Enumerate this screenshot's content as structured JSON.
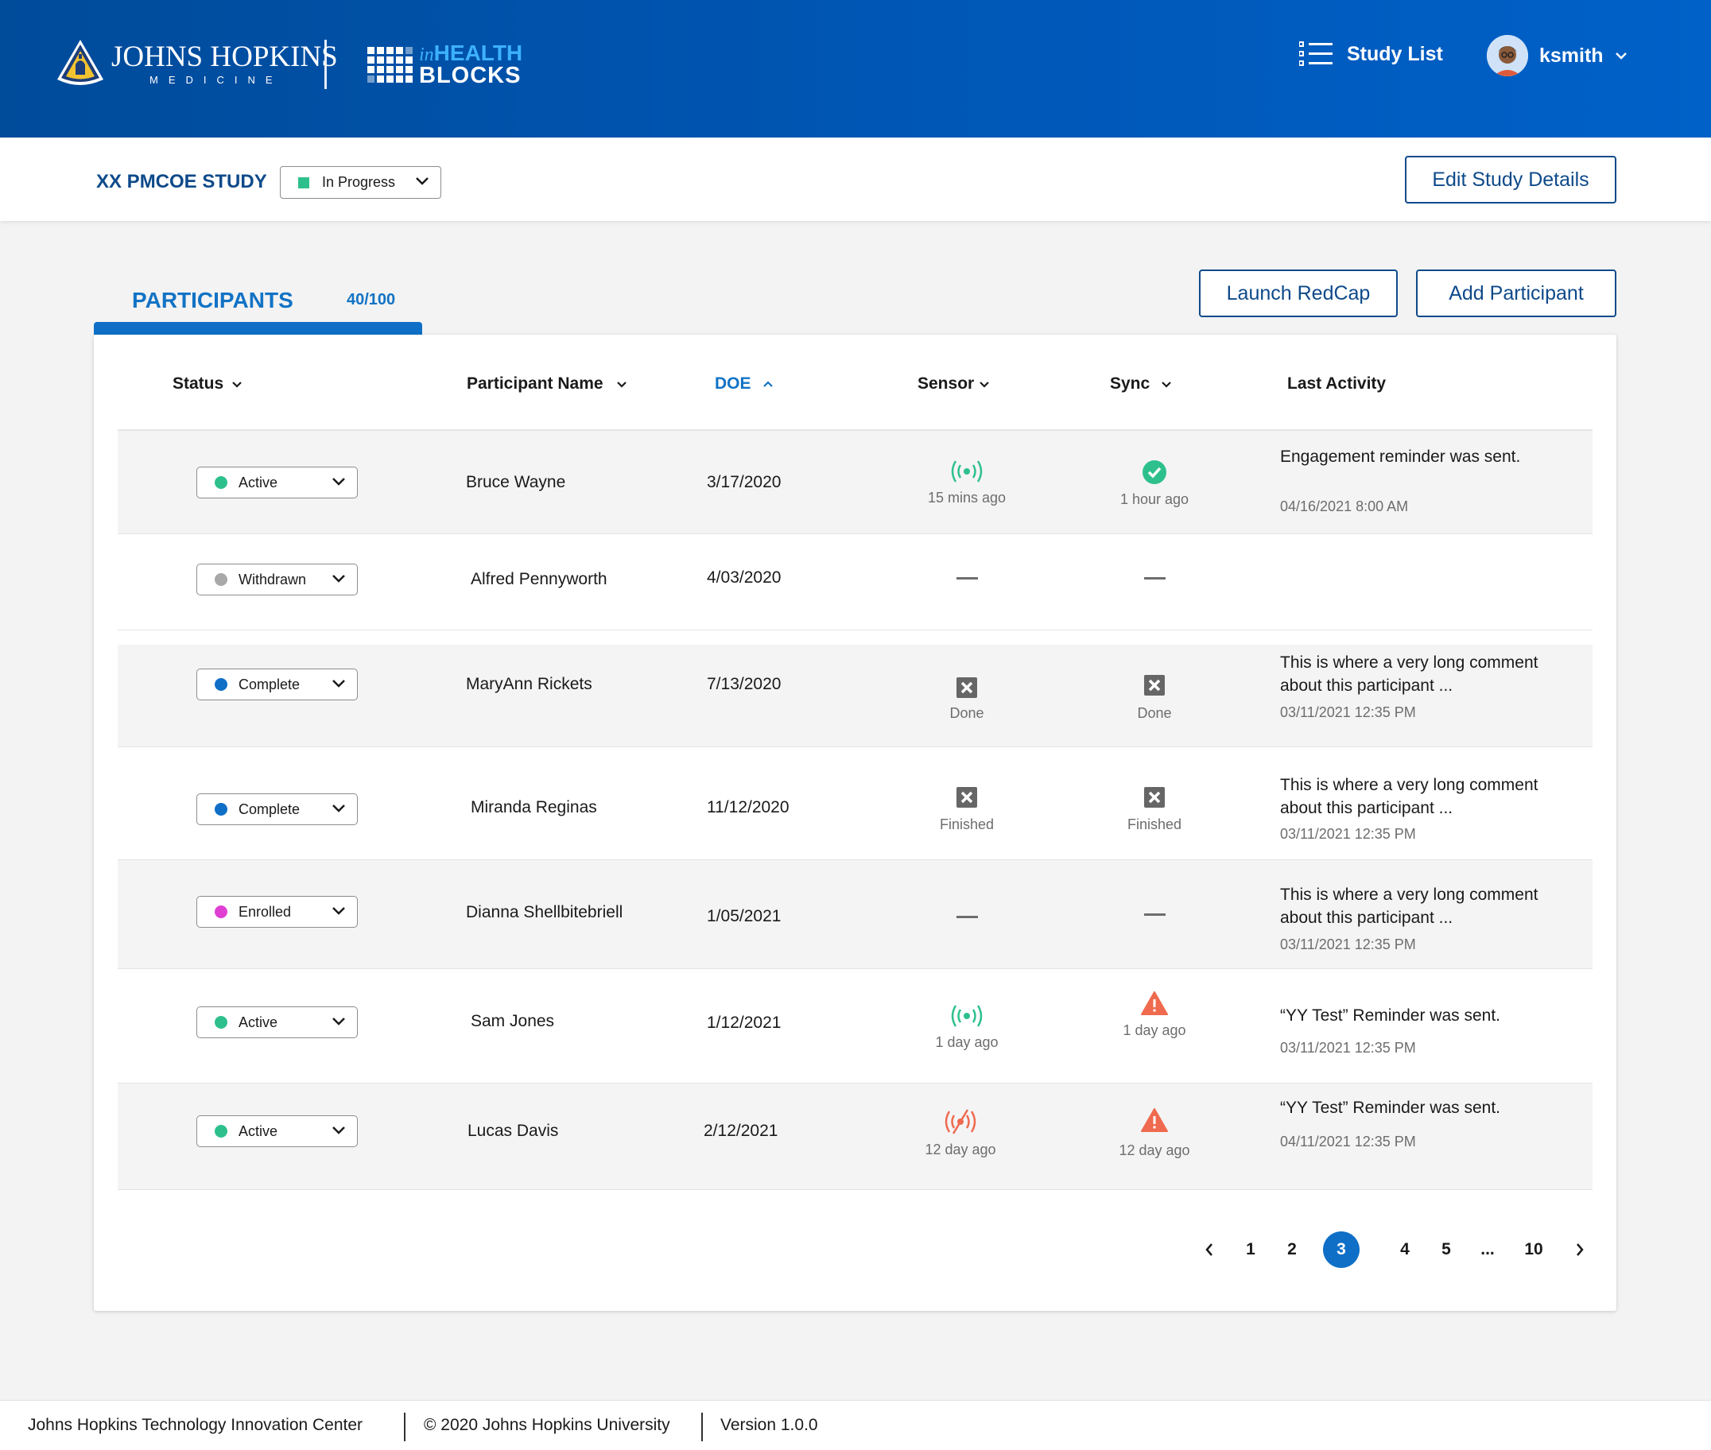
{
  "header": {
    "org_name": "JOHNS HOPKINS",
    "org_sub": "MEDICINE",
    "product_prefix": "in",
    "product_line1": "HEALTH",
    "product_line2": "BLOCKS",
    "study_list_label": "Study List",
    "username": "ksmith",
    "icons": [
      "list-icon",
      "avatar",
      "chevron-down-icon"
    ]
  },
  "study": {
    "title": "XX PMCOE STUDY",
    "status": "In Progress",
    "status_color": "#2ec08c",
    "edit_label": "Edit Study Details"
  },
  "participants": {
    "tab_label": "PARTICIPANTS",
    "count": "40/100",
    "launch_label": "Launch RedCap",
    "add_label": "Add Participant",
    "columns": [
      "Status",
      "Participant Name",
      "DOE",
      "Sensor",
      "Sync",
      "Last Activity"
    ],
    "sorted_column": "DOE",
    "rows": [
      {
        "status": "Active",
        "status_color": "#2ec08c",
        "name": "Bruce Wayne",
        "doe": "3/17/2020",
        "sensor_icon": "signal-green-icon",
        "sensor_caption": "15 mins ago",
        "sync_icon": "check-circle-icon",
        "sync_caption": "1 hour ago",
        "activity": "Engagement reminder was sent.",
        "activity_date": "04/16/2021 8:00 AM"
      },
      {
        "status": "Withdrawn",
        "status_color": "#a8a8a8",
        "name": "Alfred Pennyworth",
        "doe": "4/03/2020",
        "sensor_icon": "dash-icon",
        "sensor_caption": "",
        "sync_icon": "dash-icon",
        "sync_caption": "",
        "activity": "",
        "activity_date": ""
      },
      {
        "status": "Complete",
        "status_color": "#0f6fc6",
        "name": "MaryAnn Rickets",
        "doe": "7/13/2020",
        "sensor_icon": "x-box-icon",
        "sensor_caption": "Done",
        "sync_icon": "x-box-icon",
        "sync_caption": "Done",
        "activity": "This is where a very long comment about this participant ...",
        "activity_date": "03/11/2021 12:35 PM"
      },
      {
        "status": "Complete",
        "status_color": "#0f6fc6",
        "name": "Miranda Reginas",
        "doe": "11/12/2020",
        "sensor_icon": "x-box-icon",
        "sensor_caption": "Finished",
        "sync_icon": "x-box-icon",
        "sync_caption": "Finished",
        "activity": "This is where a very long comment about this participant ...",
        "activity_date": "03/11/2021 12:35 PM"
      },
      {
        "status": "Enrolled",
        "status_color": "#e03fd4",
        "name": "Dianna Shellbitebriell",
        "doe": "1/05/2021",
        "sensor_icon": "dash-icon",
        "sensor_caption": "",
        "sync_icon": "dash-icon",
        "sync_caption": "",
        "activity": "This is where a very long comment about this participant ...",
        "activity_date": "03/11/2021 12:35 PM"
      },
      {
        "status": "Active",
        "status_color": "#2ec08c",
        "name": "Sam Jones",
        "doe": "1/12/2021",
        "sensor_icon": "signal-green-icon",
        "sensor_caption": "1 day ago",
        "sync_icon": "warning-icon",
        "sync_caption": "1 day ago",
        "activity": "“YY Test” Reminder was sent.",
        "activity_date": "03/11/2021 12:35 PM"
      },
      {
        "status": "Active",
        "status_color": "#2ec08c",
        "name": "Lucas Davis",
        "doe": "2/12/2021",
        "sensor_icon": "signal-off-icon",
        "sensor_caption": "12 day ago",
        "sync_icon": "warning-icon",
        "sync_caption": "12 day ago",
        "activity": "“YY Test” Reminder was sent.",
        "activity_date": "04/11/2021 12:35 PM"
      }
    ],
    "pagination": {
      "pages": [
        "1",
        "2",
        "3",
        "4",
        "5",
        "...",
        "10"
      ],
      "current": "3"
    }
  },
  "footer": {
    "center": "Johns Hopkins Technology Innovation Center",
    "copyright": "© 2020 Johns Hopkins University",
    "version": "Version 1.0.0"
  }
}
